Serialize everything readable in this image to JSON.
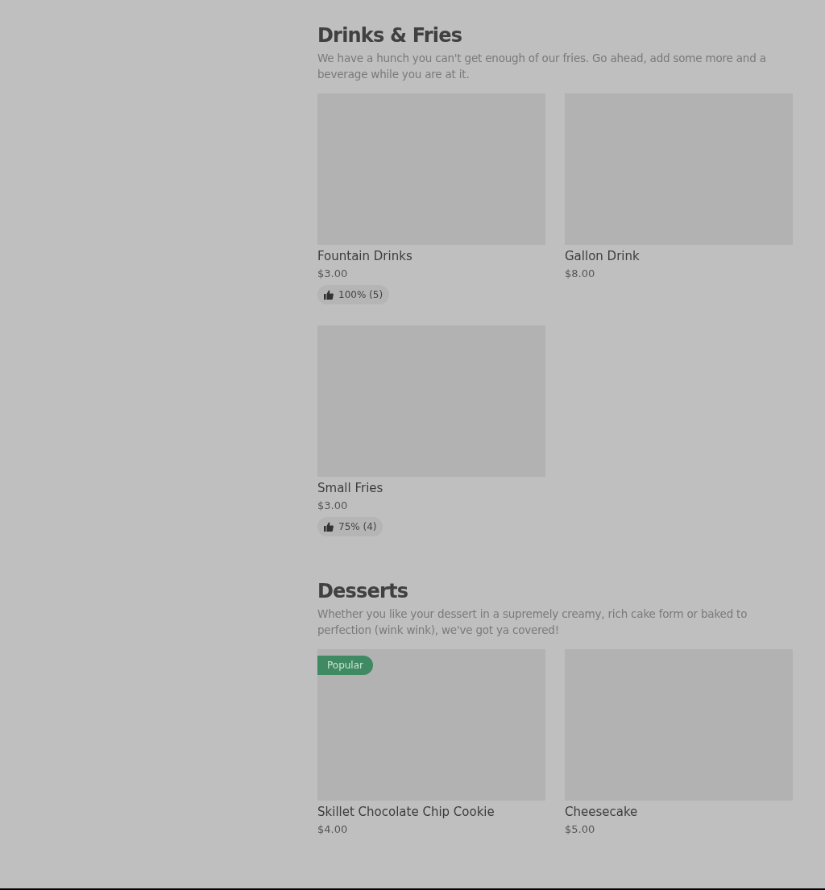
{
  "sections": [
    {
      "title": "Drinks & Fries",
      "description": "We have a hunch you can't get enough of our fries. Go ahead, add some more and a beverage while you are at it.",
      "items": [
        {
          "name": "Fountain Drinks",
          "price": "$3.00",
          "rating": "100% (5)"
        },
        {
          "name": "Gallon Drink",
          "price": "$8.00"
        },
        {
          "name": "Small Fries",
          "price": "$3.00",
          "rating": "75% (4)"
        }
      ]
    },
    {
      "title": "Desserts",
      "description": "Whether you like your dessert in a supremely creamy, rich cake form or baked to perfection (wink wink), we've got ya covered!",
      "items": [
        {
          "name": "Skillet Chocolate Chip Cookie",
          "price": "$4.00",
          "badge": "Popular"
        },
        {
          "name": "Cheesecake",
          "price": "$5.00"
        }
      ]
    }
  ]
}
